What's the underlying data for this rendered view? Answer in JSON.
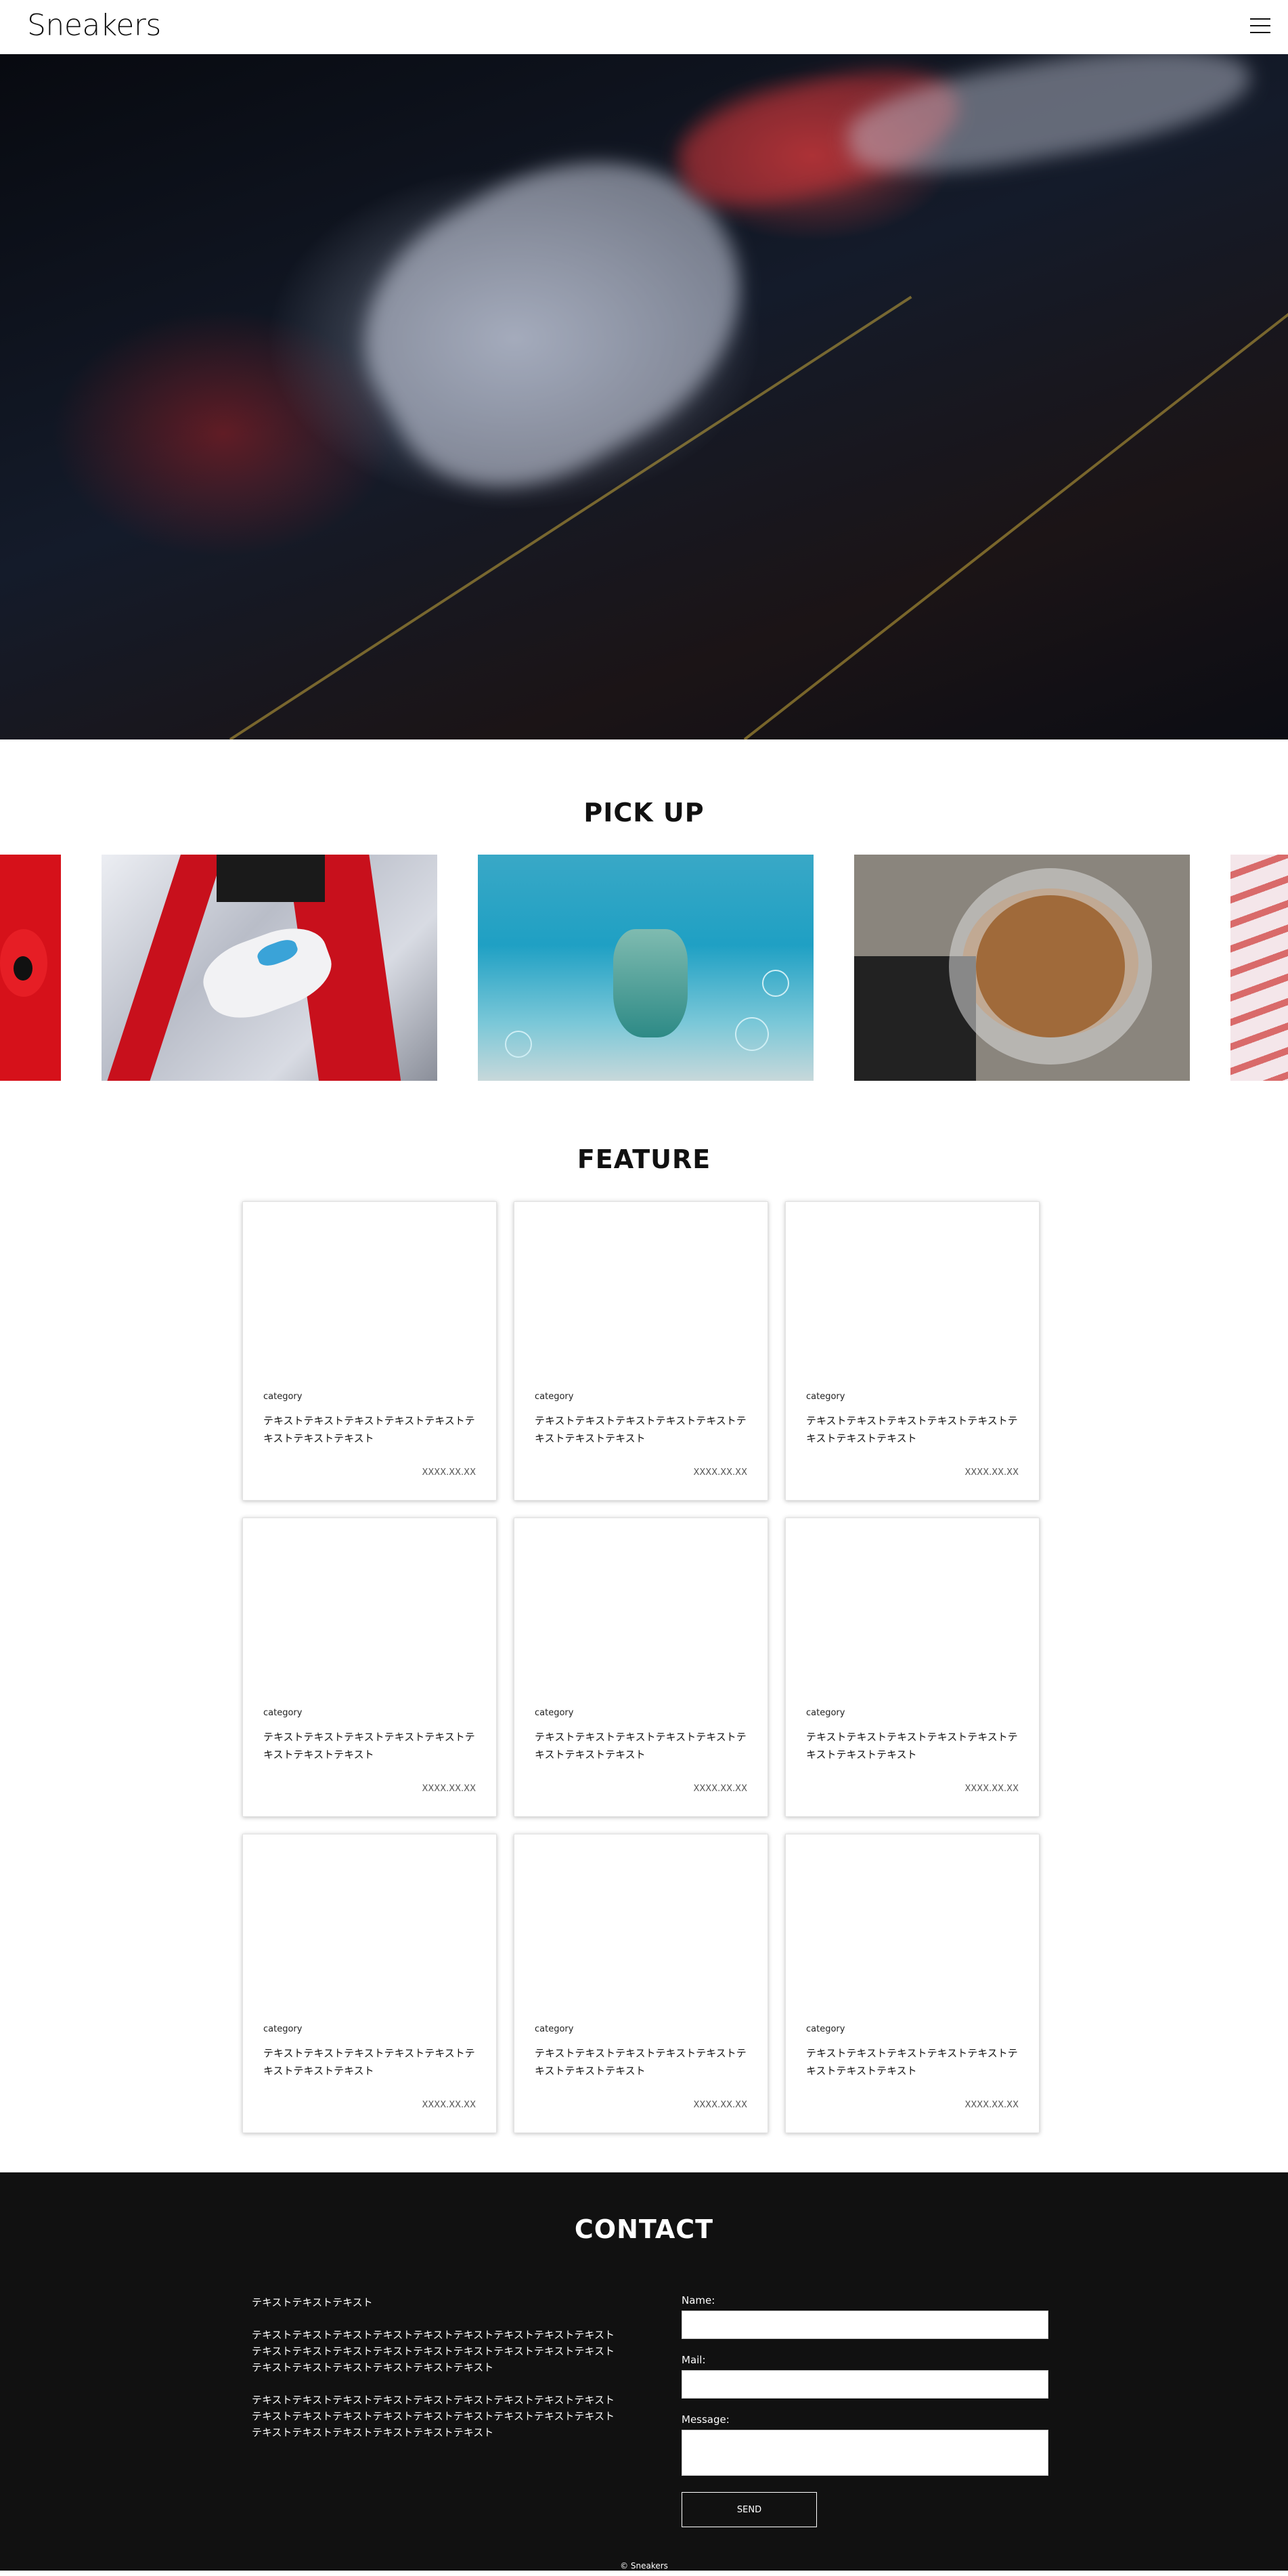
{
  "header": {
    "logo": "Sneakers",
    "menu_icon": "hamburger-icon"
  },
  "pickup": {
    "title": "PICK UP"
  },
  "feature": {
    "title": "FEATURE",
    "cards": [
      {
        "category": "category",
        "text": "テキストテキストテキストテキストテキストテキストテキストテキスト",
        "date": "XXXX.XX.XX"
      },
      {
        "category": "category",
        "text": "テキストテキストテキストテキストテキストテキストテキストテキスト",
        "date": "XXXX.XX.XX"
      },
      {
        "category": "category",
        "text": "テキストテキストテキストテキストテキストテキストテキストテキスト",
        "date": "XXXX.XX.XX"
      },
      {
        "category": "category",
        "text": "テキストテキストテキストテキストテキストテキストテキストテキスト",
        "date": "XXXX.XX.XX"
      },
      {
        "category": "category",
        "text": "テキストテキストテキストテキストテキストテキストテキストテキスト",
        "date": "XXXX.XX.XX"
      },
      {
        "category": "category",
        "text": "テキストテキストテキストテキストテキストテキストテキストテキスト",
        "date": "XXXX.XX.XX"
      },
      {
        "category": "category",
        "text": "テキストテキストテキストテキストテキストテキストテキストテキスト",
        "date": "XXXX.XX.XX"
      },
      {
        "category": "category",
        "text": "テキストテキストテキストテキストテキストテキストテキストテキスト",
        "date": "XXXX.XX.XX"
      },
      {
        "category": "category",
        "text": "テキストテキストテキストテキストテキストテキストテキストテキスト",
        "date": "XXXX.XX.XX"
      }
    ]
  },
  "contact": {
    "title": "CONTACT",
    "paragraphs": [
      "テキストテキストテキスト",
      "テキストテキストテキストテキストテキストテキストテキストテキストテキストテキストテキストテキストテキストテキストテキストテキストテキストテキストテキストテキストテキストテキストテキストテキスト",
      "テキストテキストテキストテキストテキストテキストテキストテキストテキストテキストテキストテキストテキストテキストテキストテキストテキストテキストテキストテキストテキストテキストテキストテキスト"
    ],
    "name_label": "Name:",
    "mail_label": "Mail:",
    "message_label": "Message:",
    "send_label": "SEND",
    "copyright": "© Sneakers"
  }
}
